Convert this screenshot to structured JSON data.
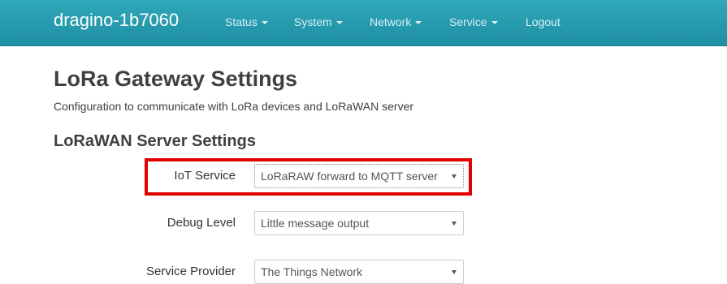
{
  "header": {
    "brand": "dragino-1b7060",
    "nav": [
      {
        "label": "Status",
        "dropdown": true
      },
      {
        "label": "System",
        "dropdown": true
      },
      {
        "label": "Network",
        "dropdown": true
      },
      {
        "label": "Service",
        "dropdown": true
      },
      {
        "label": "Logout",
        "dropdown": false
      }
    ]
  },
  "page": {
    "title": "LoRa Gateway Settings",
    "description": "Configuration to communicate with LoRa devices and LoRaWAN server"
  },
  "section": {
    "title": "LoRaWAN Server Settings",
    "fields": [
      {
        "label": "IoT Service",
        "value": "LoRaRAW forward to MQTT server"
      },
      {
        "label": "Debug Level",
        "value": "Little message output"
      },
      {
        "label": "Service Provider",
        "value": "The Things Network"
      }
    ]
  },
  "colors": {
    "navbar": "#1f8fa3",
    "highlight": "#e00000"
  },
  "icons": {
    "dropdown": "caret-down-icon"
  }
}
